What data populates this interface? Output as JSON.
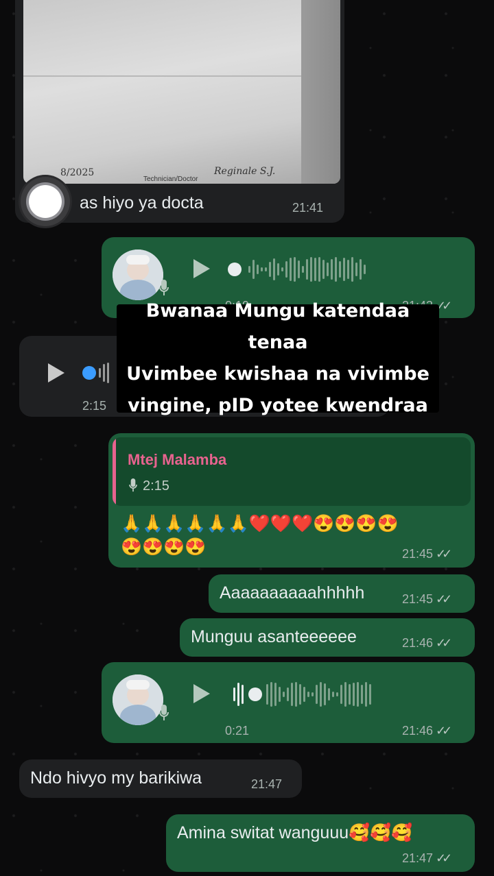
{
  "messages": {
    "photo": {
      "text": "as hiyo ya docta",
      "time": "21:41",
      "doc_text_left": "8/2025",
      "doc_text_mid": "Technician/Doctor",
      "doc_text_right": "Reginale S.J."
    },
    "voice1": {
      "duration": "0:19",
      "time": "21:43"
    },
    "voice_in": {
      "time": "2:15"
    },
    "reply": {
      "quoted_author": "Mtej Malamba",
      "quoted_duration": "2:15",
      "emojis_line1": "🙏🙏🙏🙏🙏🙏❤️❤️❤️😍😍😍😍",
      "emojis_line2": "😍😍😍😍",
      "time": "21:45"
    },
    "msg_a": {
      "text": "Aaaaaaaaaahhhhh",
      "time": "21:45"
    },
    "msg_b": {
      "text": "Munguu asanteeeeee",
      "time": "21:46"
    },
    "voice2": {
      "duration": "0:21",
      "time": "21:46"
    },
    "msg_c": {
      "text": "Ndo hivyo my barikiwa",
      "time": "21:47"
    },
    "msg_d": {
      "text": "Amina switat wanguuu🥰🥰🥰",
      "time": "21:47"
    }
  },
  "overlay": {
    "line1": "Bwanaa Mungu katendaa tenaa",
    "line2": "Uvimbee kwishaa na vivimbe",
    "line3": "vingine, pID yotee kwendraa"
  },
  "colors": {
    "incoming": "#1f2022",
    "outgoing": "#1d5d3a",
    "accent_author": "#e8638f"
  }
}
